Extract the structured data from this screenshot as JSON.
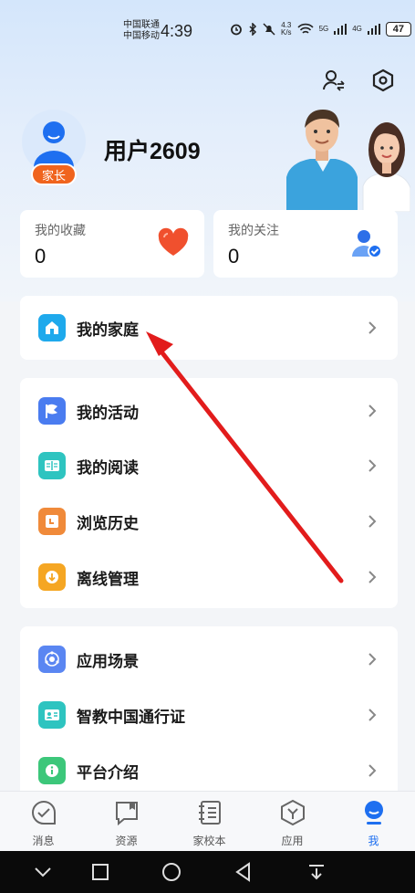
{
  "status_bar": {
    "carrier_1": "中国联通",
    "carrier_2": "中国移动",
    "time": "4:39",
    "net_speed_value": "4.3",
    "net_speed_unit": "K/s",
    "signal_1": "5G",
    "signal_2": "4G",
    "battery": "47"
  },
  "profile": {
    "username": "用户2609",
    "role_badge": "家长"
  },
  "stats": {
    "favorites_label": "我的收藏",
    "favorites_count": "0",
    "following_label": "我的关注",
    "following_count": "0"
  },
  "menu": {
    "family": "我的家庭",
    "activities": "我的活动",
    "reading": "我的阅读",
    "history": "浏览历史",
    "offline": "离线管理",
    "scenarios": "应用场景",
    "pass": "智教中国通行证",
    "about": "平台介绍"
  },
  "bottom_nav": {
    "messages": "消息",
    "resources": "资源",
    "home_school": "家校本",
    "apps": "应用",
    "me": "我"
  },
  "colors": {
    "accent": "#1e6ff0",
    "badge": "#f0641e",
    "heart": "#f0502e",
    "arrow": "#e21c1c"
  }
}
